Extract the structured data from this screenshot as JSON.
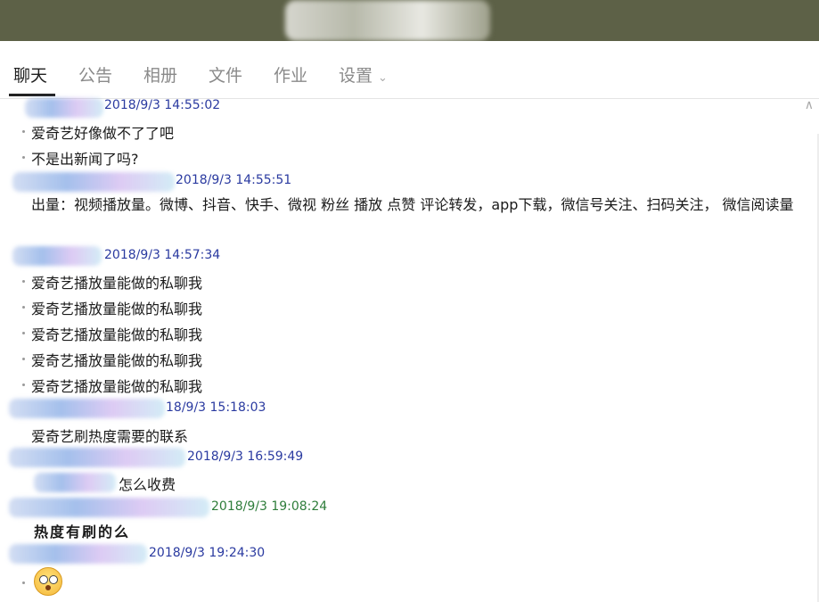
{
  "tabs": [
    {
      "label": "聊天"
    },
    {
      "label": "公告"
    },
    {
      "label": "相册"
    },
    {
      "label": "文件"
    },
    {
      "label": "作业"
    },
    {
      "label": "设置"
    }
  ],
  "icons": {
    "scroll_up": "chevron-up-icon",
    "settings_dropdown": "chevron-down-icon"
  },
  "messages": [
    {
      "time": "2018/9/3 14:55:02",
      "lines": [
        "爱奇艺好像做不了了吧",
        "不是出新闻了吗?"
      ]
    },
    {
      "time": "2018/9/3 14:55:51",
      "lines": [
        "出量：视频播放量。微博、抖音、快手、微视  粉丝 播放 点赞 评论转发，app下载，微信号关注、扫码关注， 微信阅读量"
      ]
    },
    {
      "time": "2018/9/3 14:57:34",
      "lines": [
        "爱奇艺播放量能做的私聊我",
        "爱奇艺播放量能做的私聊我",
        "爱奇艺播放量能做的私聊我",
        "爱奇艺播放量能做的私聊我",
        "爱奇艺播放量能做的私聊我"
      ]
    },
    {
      "time": "18/9/3 15:18:03",
      "lines": [
        "爱奇艺刷热度需要的联系"
      ]
    },
    {
      "time": "2018/9/3 16:59:49",
      "lines": [
        "怎么收费"
      ]
    },
    {
      "time": "2018/9/3 19:08:24",
      "lines": [
        "热度有刷的么"
      ]
    },
    {
      "time": "2018/9/3 19:24:30",
      "lines": []
    }
  ],
  "colors": {
    "timestamp": "#2a3aa0",
    "timestamp_alt": "#2e7d3a",
    "topbar": "#5d6147"
  }
}
